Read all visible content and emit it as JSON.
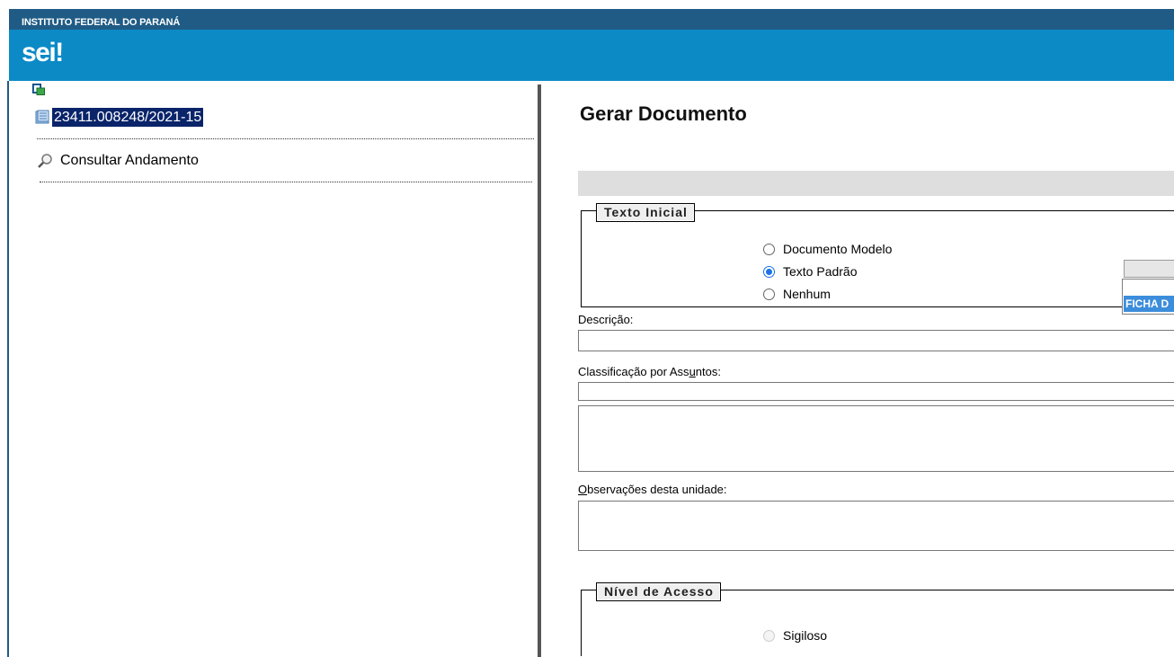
{
  "header": {
    "institution": "INSTITUTO FEDERAL DO PARANÁ",
    "logo_text": "sei",
    "logo_bang": "!"
  },
  "sidebar": {
    "process_number": "23411.008248/2021-15",
    "consult_label": "Consultar Andamento"
  },
  "main": {
    "title": "Gerar Documento",
    "texto_inicial": {
      "legend": "Texto Inicial",
      "options": [
        {
          "label": "Documento Modelo",
          "checked": false
        },
        {
          "label": "Texto Padrão",
          "checked": true
        },
        {
          "label": "Nenhum",
          "checked": false
        }
      ],
      "selected_template": "FICHA D"
    },
    "descricao_label": "Descrição:",
    "descricao_value": "",
    "classificacao_label_pre": "Classificação por Ass",
    "classificacao_label_u": "u",
    "classificacao_label_post": "ntos:",
    "observacoes_label_u": "O",
    "observacoes_label_post": "bservações desta unidade:",
    "nivel_acesso": {
      "legend": "Nível de Acesso",
      "options": [
        {
          "label": "Sigiloso",
          "disabled": true
        }
      ]
    }
  },
  "colors": {
    "institution_bar": "#1f5b85",
    "brand_bar": "#0b8ac6",
    "selection": "#0a246a",
    "radio_accent": "#1a73e8"
  }
}
